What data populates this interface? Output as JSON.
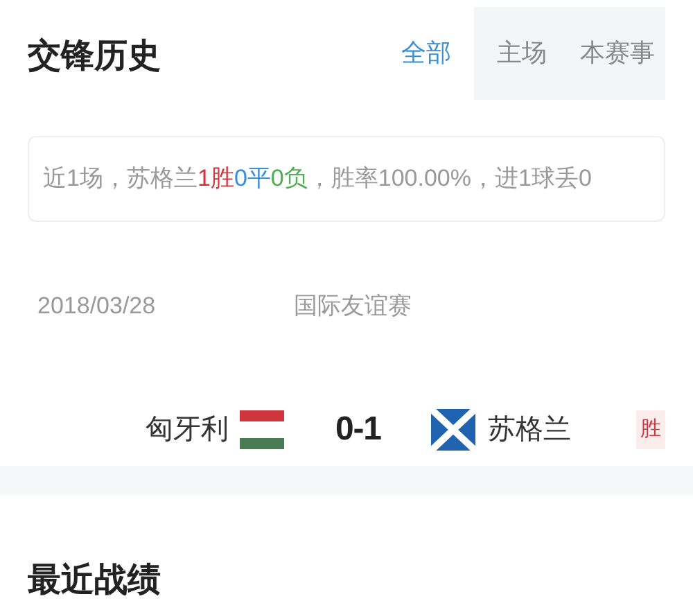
{
  "head_to_head": {
    "title": "交锋历史",
    "tabs": [
      {
        "label": "全部",
        "selected": true
      },
      {
        "label": "主场",
        "selected": false
      },
      {
        "label": "本赛事",
        "selected": false
      }
    ],
    "summary": [
      {
        "text": "近1场，苏格兰"
      },
      {
        "text": "1胜",
        "color": "#d0343c"
      },
      {
        "text": "0平",
        "color": "#3a8fd9"
      },
      {
        "text": "0负",
        "color": "#4caf50"
      },
      {
        "text": "，胜率100.00%，进1球丢0"
      }
    ],
    "matches": [
      {
        "date": "2018/03/28",
        "competition": "国际友谊赛",
        "home": "匈牙利",
        "score": "0-1",
        "away": "苏格兰",
        "result": "胜"
      }
    ]
  },
  "recent_form": {
    "title": "最近战绩"
  }
}
